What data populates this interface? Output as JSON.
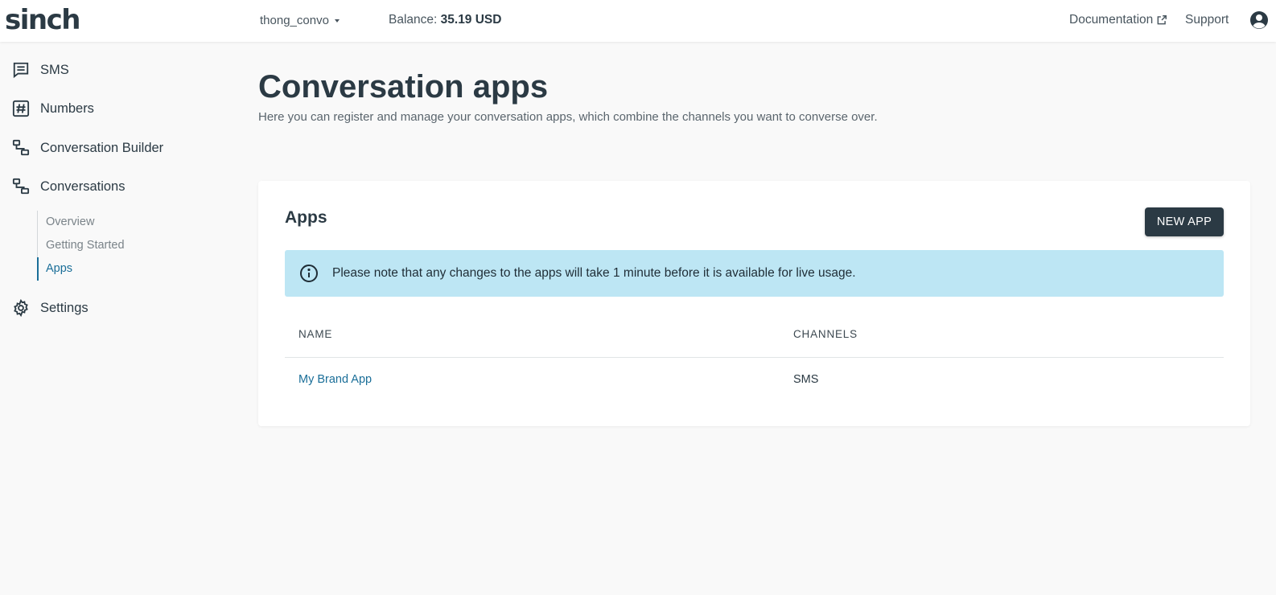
{
  "header": {
    "logo": "sinch",
    "account_name": "thong_convo",
    "balance_label": "Balance:",
    "balance_value": "35.19 USD",
    "documentation": "Documentation",
    "support": "Support"
  },
  "sidebar": {
    "items": [
      {
        "label": "SMS",
        "icon": "chat-icon"
      },
      {
        "label": "Numbers",
        "icon": "hash-icon"
      },
      {
        "label": "Conversation Builder",
        "icon": "conversation-builder-icon"
      },
      {
        "label": "Conversations",
        "icon": "conversations-icon"
      },
      {
        "label": "Settings",
        "icon": "gear-icon"
      }
    ],
    "sub_items": [
      {
        "label": "Overview",
        "active": false
      },
      {
        "label": "Getting Started",
        "active": false
      },
      {
        "label": "Apps",
        "active": true
      }
    ]
  },
  "page": {
    "title": "Conversation apps",
    "subtitle": "Here you can register and manage your conversation apps, which combine the channels you want to converse over."
  },
  "apps_card": {
    "title": "Apps",
    "new_button": "NEW APP",
    "notice": "Please note that any changes to the apps will take 1 minute before it is available for live usage.",
    "columns": [
      "NAME",
      "CHANNELS"
    ],
    "rows": [
      {
        "name": "My Brand App",
        "channels": "SMS"
      }
    ]
  },
  "colors": {
    "primary_dark": "#2b3a44",
    "link": "#1a6e98",
    "notice_bg": "#bde6f4",
    "page_bg": "#f9f9f9"
  }
}
